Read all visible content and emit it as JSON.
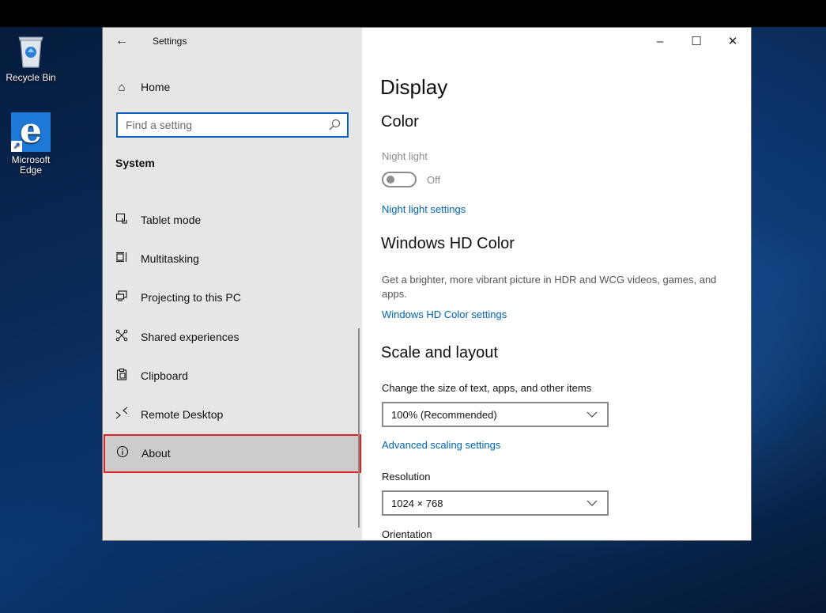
{
  "desktop": {
    "icons": [
      {
        "label": "Recycle Bin",
        "icon": "recycle-bin-icon"
      },
      {
        "label": "Microsoft Edge",
        "icon": "edge-icon"
      }
    ]
  },
  "window": {
    "title": "Settings",
    "controls": {
      "minimize": "–",
      "maximize": "☐",
      "close": "✕"
    }
  },
  "sidebar": {
    "home_label": "Home",
    "search_placeholder": "Find a setting",
    "section_title": "System",
    "items": [
      {
        "label": "Tablet mode",
        "icon": "tablet-mode-icon"
      },
      {
        "label": "Multitasking",
        "icon": "multitasking-icon"
      },
      {
        "label": "Projecting to this PC",
        "icon": "projecting-icon"
      },
      {
        "label": "Shared experiences",
        "icon": "shared-experiences-icon"
      },
      {
        "label": "Clipboard",
        "icon": "clipboard-icon"
      },
      {
        "label": "Remote Desktop",
        "icon": "remote-desktop-icon"
      },
      {
        "label": "About",
        "icon": "info-icon",
        "selected": true
      }
    ]
  },
  "main": {
    "page_title": "Display",
    "color_heading": "Color",
    "night_light_label": "Night light",
    "night_light_state": "Off",
    "night_light_link": "Night light settings",
    "hdr_heading": "Windows HD Color",
    "hdr_desc": "Get a brighter, more vibrant picture in HDR and WCG videos, games, and apps.",
    "hdr_link": "Windows HD Color settings",
    "scale_heading": "Scale and layout",
    "scale_label": "Change the size of text, apps, and other items",
    "scale_value": "100% (Recommended)",
    "advanced_scaling_link": "Advanced scaling settings",
    "resolution_label": "Resolution",
    "resolution_value": "1024 × 768",
    "orientation_label": "Orientation"
  },
  "colors": {
    "accent": "#0063b1",
    "sidebar_bg": "#e6e6e6",
    "selected_bg": "#cccccc",
    "highlight_outline": "#e02020"
  }
}
